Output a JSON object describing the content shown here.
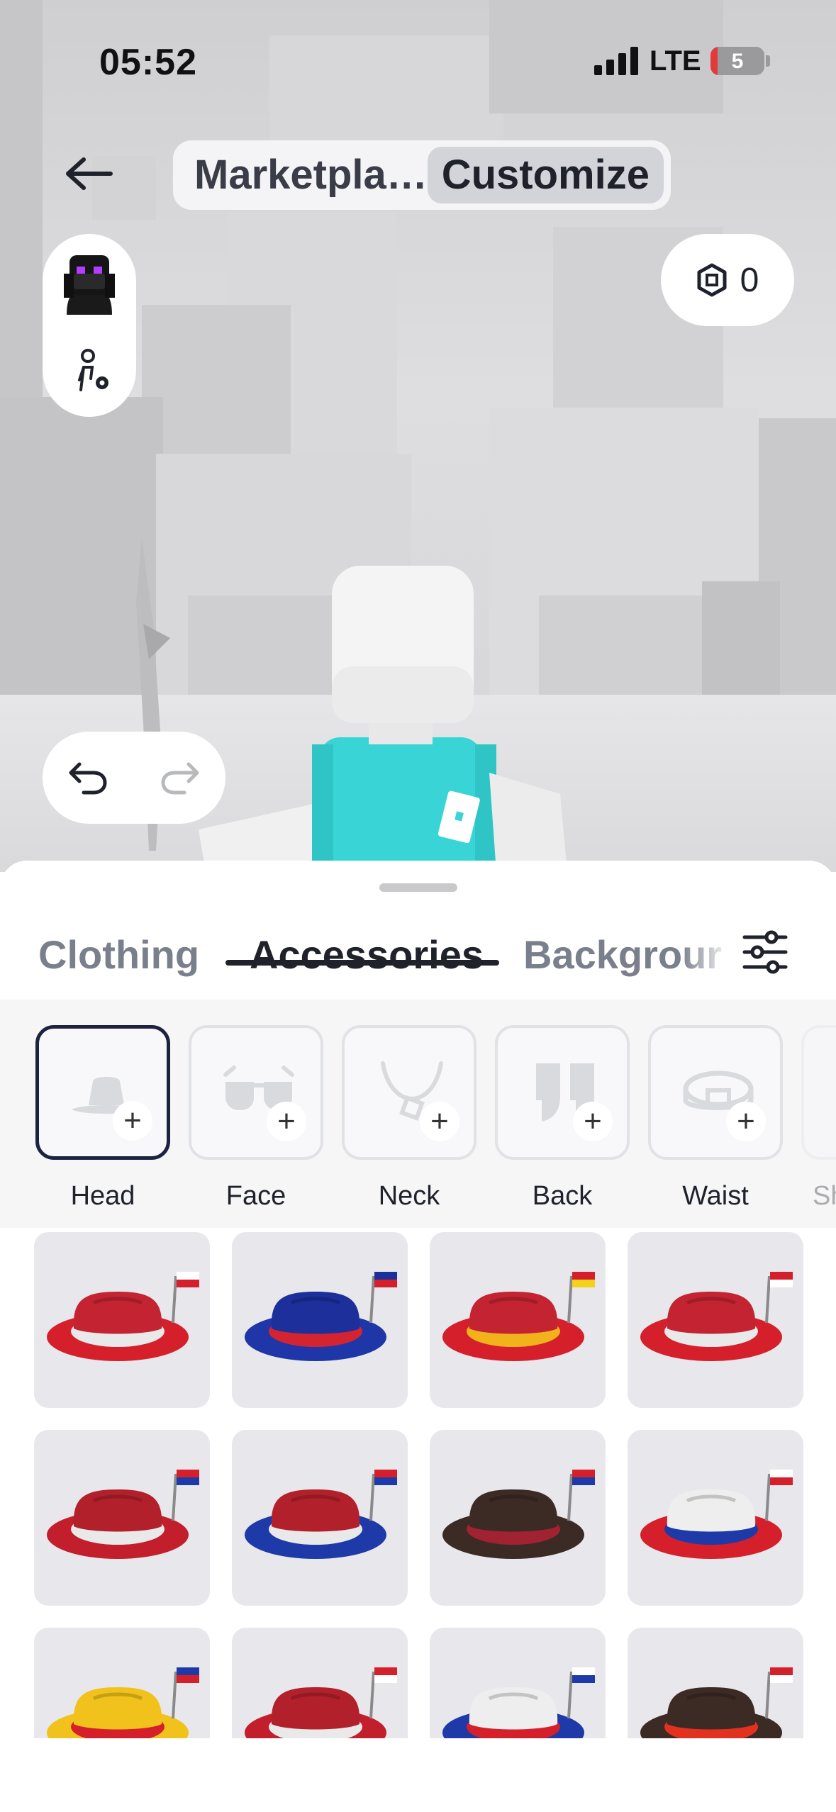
{
  "status_bar": {
    "time": "05:52",
    "network": "LTE",
    "battery": "5"
  },
  "header": {
    "tabs": [
      {
        "label": "Marketpla…",
        "active": false
      },
      {
        "label": "Customize",
        "active": true
      }
    ]
  },
  "robux": {
    "balance": "0"
  },
  "sheet": {
    "tabs": [
      {
        "label": "Clothing",
        "active": false
      },
      {
        "label": "Accessories",
        "active": true
      },
      {
        "label": "Backgrour",
        "active": false
      }
    ],
    "categories": [
      {
        "label": "Head",
        "icon": "hat-icon",
        "selected": true
      },
      {
        "label": "Face",
        "icon": "glasses-icon",
        "selected": false
      },
      {
        "label": "Neck",
        "icon": "necklace-icon",
        "selected": false
      },
      {
        "label": "Back",
        "icon": "wings-icon",
        "selected": false
      },
      {
        "label": "Waist",
        "icon": "belt-icon",
        "selected": false
      },
      {
        "label": "Sh",
        "icon": "shoulder-icon",
        "selected": false
      }
    ],
    "items": [
      {
        "hat": "#c42432",
        "band": "#e9e9ea",
        "brim": "#d5202c",
        "flag": "poland-flag"
      },
      {
        "hat": "#1c2f9a",
        "band": "#d42432",
        "brim": "#1f36a8",
        "flag": "australia-flag"
      },
      {
        "hat": "#c42432",
        "band": "#f2b21b",
        "brim": "#d5202c",
        "flag": "china-flag"
      },
      {
        "hat": "#c42432",
        "band": "#e9e9ea",
        "brim": "#d5202c",
        "flag": "turkey-flag"
      },
      {
        "hat": "#b2202c",
        "band": "#e9e9ea",
        "brim": "#c21e2b",
        "flag": "thailand-flag"
      },
      {
        "hat": "#b2202c",
        "band": "#e9e9ea",
        "brim": "#1e3aa8",
        "flag": "netherlands-flag"
      },
      {
        "hat": "#3c2a24",
        "band": "#a12231",
        "brim": "#3c2a24",
        "flag": "usa-flag"
      },
      {
        "hat": "#eeeeee",
        "band": "#1e3aa8",
        "brim": "#d5202c",
        "flag": "chile-flag"
      },
      {
        "hat": "#f1c21b",
        "band": "#d5202c",
        "brim": "#f1c21b",
        "flag": "philippines-flag"
      },
      {
        "hat": "#b2202c",
        "band": "#e9e9ea",
        "brim": "#c21e2b",
        "flag": "indonesia-flag"
      },
      {
        "hat": "#eeeeee",
        "band": "#d5202c",
        "brim": "#1e3aa8",
        "flag": "korea-flag"
      },
      {
        "hat": "#3c2a24",
        "band": "#e2321f",
        "brim": "#3c2a24",
        "flag": "canada-flag"
      }
    ]
  },
  "colors": {
    "accent": "#1c2240",
    "tile_bg": "#e8e8ec",
    "active_text": "#1f222b",
    "inactive_text": "#7a7f8c"
  }
}
